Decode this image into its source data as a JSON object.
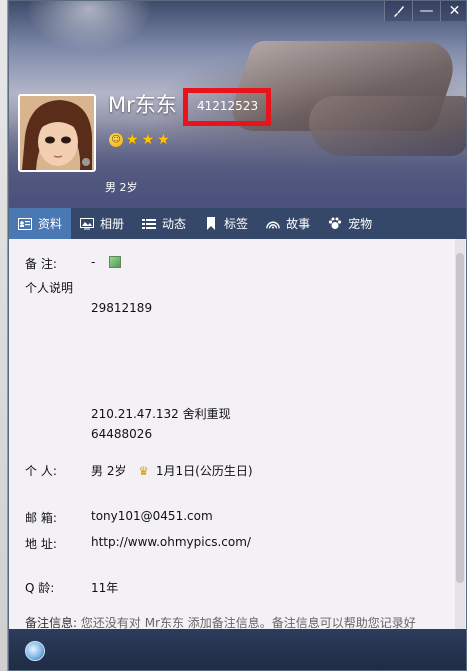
{
  "window": {
    "nickname": "Mr东东",
    "qq_number": "41212523",
    "gender_age": "男   2岁",
    "titlebar": {
      "skin_icon": "paintbrush-icon",
      "minimize_label": "—",
      "close_label": "✕"
    }
  },
  "tabs": [
    {
      "label": "资料",
      "icon": "profile-card-icon",
      "active": true
    },
    {
      "label": "相册",
      "icon": "photo-album-icon"
    },
    {
      "label": "动态",
      "icon": "feed-list-icon"
    },
    {
      "label": "标签",
      "icon": "bookmark-icon"
    },
    {
      "label": "故事",
      "icon": "rainbow-icon"
    },
    {
      "label": "宠物",
      "icon": "pet-paw-icon"
    }
  ],
  "profile": {
    "remark_label": "备    注:",
    "remark_value": "-",
    "intro_label": "个人说明",
    "intro_line1": "29812189",
    "intro_line2": "210.21.47.132 舍利重现",
    "intro_line3": "64488026",
    "person_label": "个    人:",
    "person_value_gender": "男   2岁",
    "person_birthday": "1月1日(公历生日)",
    "email_label": "邮    箱:",
    "email_value": "tony101@0451.com",
    "address_label": "地    址:",
    "address_value": "http://www.ohmypics.com/",
    "qage_label": "Q     龄:",
    "qage_value": "11年",
    "footer_label": "备注信息:",
    "footer_text": "您还没有对 Mr东东 添加备注信息。备注信息可以帮助您记录好"
  }
}
